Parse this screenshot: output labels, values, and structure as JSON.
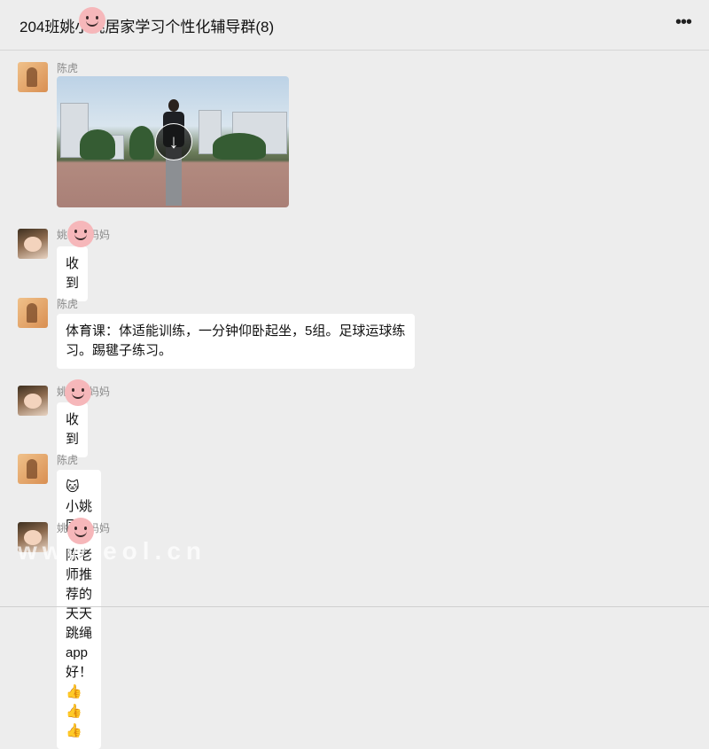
{
  "header": {
    "title": "204班姚小姚居家学习个性化辅导群(8)",
    "more_icon": "more-icon"
  },
  "messages": [
    {
      "sender": "陈虎",
      "type": "video",
      "avatar": "tiger-avatar"
    },
    {
      "sender": "姚小姚妈妈",
      "type": "text",
      "text": "收到",
      "avatar": "baby-avatar"
    },
    {
      "sender": "陈虎",
      "type": "text",
      "text": "体育课：体适能训练，一分钟仰卧起坐，5组。足球运球练习。踢毽子练习。",
      "avatar": "tiger-avatar"
    },
    {
      "sender": "姚小姚妈妈",
      "type": "text",
      "text": "收到",
      "avatar": "baby-avatar"
    },
    {
      "sender": "陈虎",
      "type": "text",
      "text": "🐱小姚同学，现在跳绳越来越棒了",
      "avatar": "tiger-avatar"
    },
    {
      "sender": "姚小姚妈妈",
      "type": "text",
      "text": "陈老师推荐的天天跳绳app好！👍👍👍",
      "avatar": "baby-avatar"
    }
  ],
  "watermark": "www.eol.cn"
}
